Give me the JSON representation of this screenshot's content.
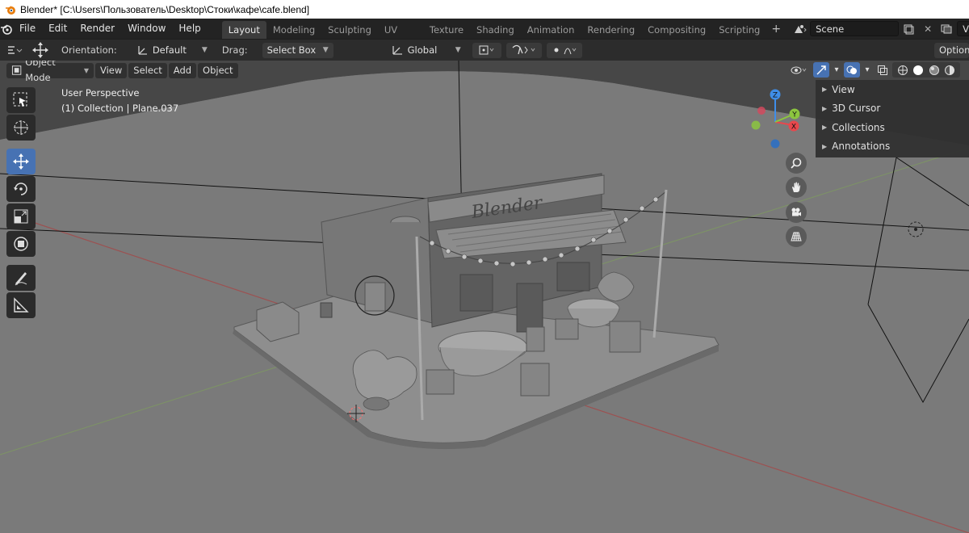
{
  "window": {
    "title": "Blender* [C:\\Users\\Пользователь\\Desktop\\Стоки\\кафе\\cafe.blend]"
  },
  "menu": {
    "file": "File",
    "edit": "Edit",
    "render": "Render",
    "window": "Window",
    "help": "Help"
  },
  "workspaces": [
    {
      "label": "Layout"
    },
    {
      "label": "Modeling"
    },
    {
      "label": "Sculpting"
    },
    {
      "label": "UV Editing"
    },
    {
      "label": "Texture Paint"
    },
    {
      "label": "Shading"
    },
    {
      "label": "Animation"
    },
    {
      "label": "Rendering"
    },
    {
      "label": "Compositing"
    },
    {
      "label": "Scripting"
    }
  ],
  "scene": {
    "name": "Scene",
    "view_layer": "View"
  },
  "toolbar": {
    "orientation_label": "Orientation:",
    "orientation_value": "Default",
    "drag_label": "Drag:",
    "drag_value": "Select Box",
    "transform_orientation": "Global",
    "options": "Options"
  },
  "viewport_header": {
    "mode": "Object Mode",
    "view": "View",
    "select": "Select",
    "add": "Add",
    "object": "Object"
  },
  "overlay": {
    "perspective": "User Perspective",
    "collection": "(1) Collection | Plane.037"
  },
  "npanel": {
    "items": [
      {
        "label": "View"
      },
      {
        "label": "3D Cursor"
      },
      {
        "label": "Collections"
      },
      {
        "label": "Annotations"
      }
    ]
  },
  "gizmo": {
    "x": "X",
    "y": "Y",
    "z": "Z"
  },
  "scene_sign": "Blender",
  "colors": {
    "x_axis": "#e8474c",
    "y_axis": "#8cc63f",
    "z_axis": "#3f8ee8",
    "accent": "#4772b3"
  }
}
